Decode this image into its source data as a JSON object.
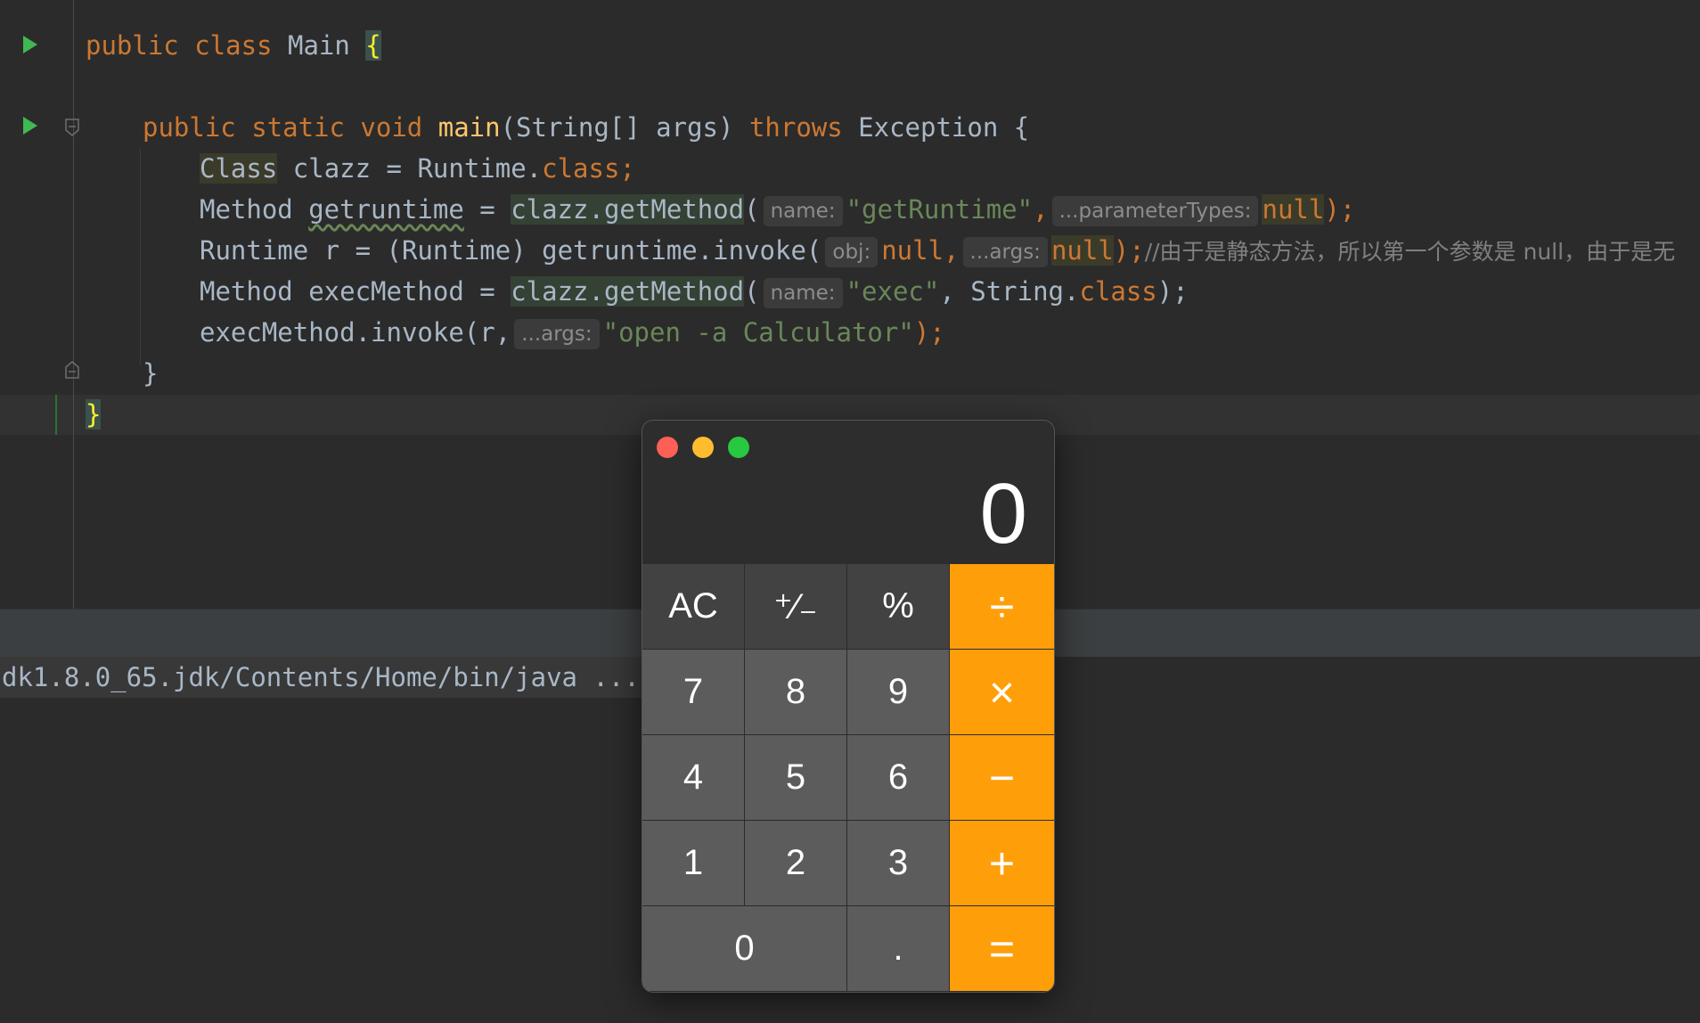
{
  "editor": {
    "line1": {
      "kw": "public class ",
      "name": "Main ",
      "brace": "{"
    },
    "line2": {
      "kw1": "public static void ",
      "fn": "main",
      "params": "(String[] args) ",
      "kw2": "throws",
      "rest": " Exception {"
    },
    "line3": {
      "type": "Class",
      "rest": " clazz = Runtime.",
      "kw": "class",
      "end": ";"
    },
    "line4": {
      "pre": "Method ",
      "var": "getruntime",
      "eq": " = ",
      "call": "clazz.getMethod",
      "open": "(",
      "hint1": "name:",
      "str": "\"getRuntime\"",
      "comma": ",",
      "hint2": "...parameterTypes:",
      "nul": "null",
      "end": ");"
    },
    "line5": {
      "pre": "Runtime r = (Runtime) getruntime.invoke(",
      "hint1": "obj:",
      "nul1": "null",
      "comma": ",",
      "hint2": "...args:",
      "nul2": "null",
      "end": ");",
      "comment": "//由于是静态方法，所以第一个参数是 null，由于是无"
    },
    "line6": {
      "pre": "Method execMethod = ",
      "call": "clazz.getMethod",
      "open": "(",
      "hint": "name:",
      "str": "\"exec\"",
      "comma": ", String.",
      "kw": "class",
      "end": ");"
    },
    "line7": {
      "pre": "execMethod.invoke(r,",
      "hint": "...args:",
      "str": "\"open -a Calculator\"",
      "end": ");"
    },
    "line8": {
      "brace": "}"
    },
    "line9": {
      "brace": "}"
    }
  },
  "console": {
    "line": "dk1.8.0_65.jdk/Contents/Home/bin/java ..."
  },
  "calculator": {
    "display": "0",
    "keys": {
      "ac": "AC",
      "sign": "⁺∕₋",
      "percent": "%",
      "divide": "÷",
      "seven": "7",
      "eight": "8",
      "nine": "9",
      "multiply": "×",
      "four": "4",
      "five": "5",
      "six": "6",
      "minus": "−",
      "one": "1",
      "two": "2",
      "three": "3",
      "plus": "+",
      "zero": "0",
      "dot": ".",
      "equals": "="
    },
    "colors": {
      "close": "#fe5f57",
      "minimize": "#febc2e",
      "zoom": "#28c840",
      "operator": "#fe9f0a"
    }
  }
}
